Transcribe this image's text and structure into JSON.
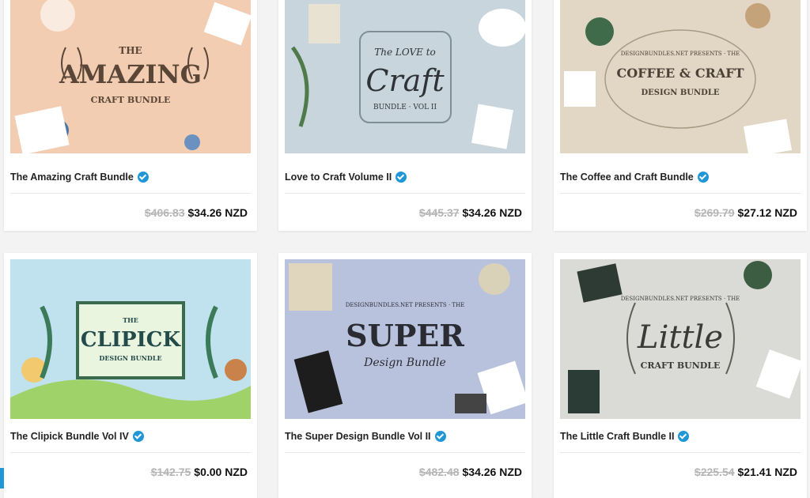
{
  "products": [
    {
      "title": "The Amazing Craft Bundle",
      "old_price": "$406.83",
      "new_price": "$34.26 NZD",
      "art": {
        "line1": "THE",
        "line2": "AMAZING",
        "line3": "CRAFT BUNDLE",
        "bg": "#f3cdb2",
        "ink": "#5a4637"
      }
    },
    {
      "title": "Love to Craft Volume II",
      "old_price": "$445.37",
      "new_price": "$34.26 NZD",
      "art": {
        "line1": "The LOVE to",
        "line2": "Craft",
        "line3": "BUNDLE · VOL II",
        "bg": "#c9d5dd",
        "ink": "#2f3338"
      }
    },
    {
      "title": "The Coffee and Craft Bundle",
      "old_price": "$269.79",
      "new_price": "$27.12 NZD",
      "art": {
        "line1": "DESIGNBUNDLES.NET PRESENTS · THE",
        "line2": "COFFEE & CRAFT",
        "line3": "DESIGN BUNDLE",
        "bg": "#e2d6c5",
        "ink": "#4b4137"
      }
    },
    {
      "title": "The Clipick Bundle Vol IV",
      "old_price": "$142.75",
      "new_price": "$0.00 NZD",
      "art": {
        "line1": "THE",
        "line2": "CLIPICK",
        "line3": "DESIGN BUNDLE",
        "bg": "#bfe2ee",
        "ink": "#234b4a"
      }
    },
    {
      "title": "The Super Design Bundle Vol II",
      "old_price": "$482.48",
      "new_price": "$34.26 NZD",
      "art": {
        "line1": "DESIGNBUNDLES.NET PRESENTS · THE",
        "line2": "SUPER",
        "line3": "Design Bundle",
        "bg": "#b9c2dd",
        "ink": "#2b2c33"
      }
    },
    {
      "title": "The Little Craft Bundle II",
      "old_price": "$225.54",
      "new_price": "$21.41 NZD",
      "art": {
        "line1": "DESIGNBUNDLES.NET PRESENTS · THE",
        "line2": "Little",
        "line3": "CRAFT BUNDLE",
        "bg": "#dadad6",
        "ink": "#3a3a38"
      }
    }
  ],
  "colors": {
    "accent": "#2196d6",
    "page_bg": "#f3f3f3"
  }
}
